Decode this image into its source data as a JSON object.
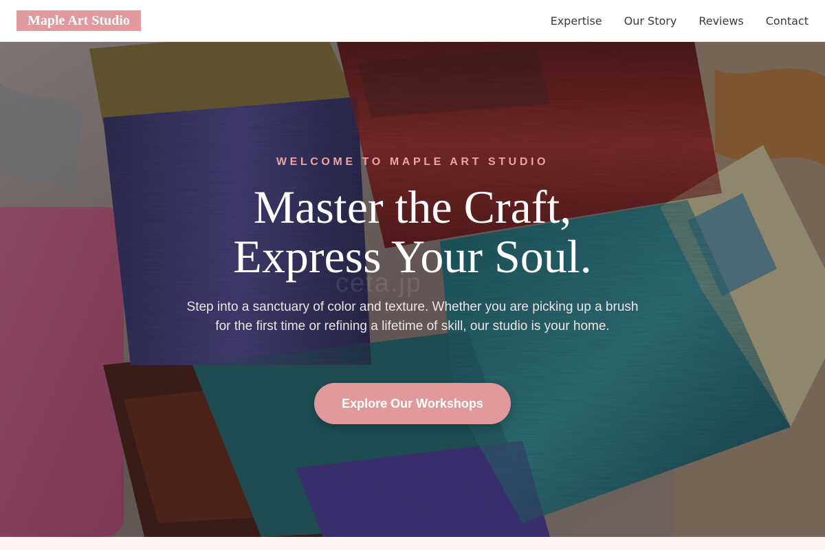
{
  "brand": {
    "name": "Maple Art Studio",
    "accent_color": "#e09a9c"
  },
  "nav": {
    "links": [
      "Expertise",
      "Our Story",
      "Reviews",
      "Contact"
    ]
  },
  "hero": {
    "eyebrow": "WELCOME TO MAPLE ART STUDIO",
    "headline_line1": "Master the Craft,",
    "headline_line2": "Express Your Soul.",
    "subtext": "Step into a sanctuary of color and texture. Whether you are picking up a brush for the first time or refining a lifetime of skill, our studio is your home.",
    "cta_label": "Explore Our Workshops",
    "watermark": "ceta.jp",
    "background_image": "paint-brushes-photo"
  }
}
